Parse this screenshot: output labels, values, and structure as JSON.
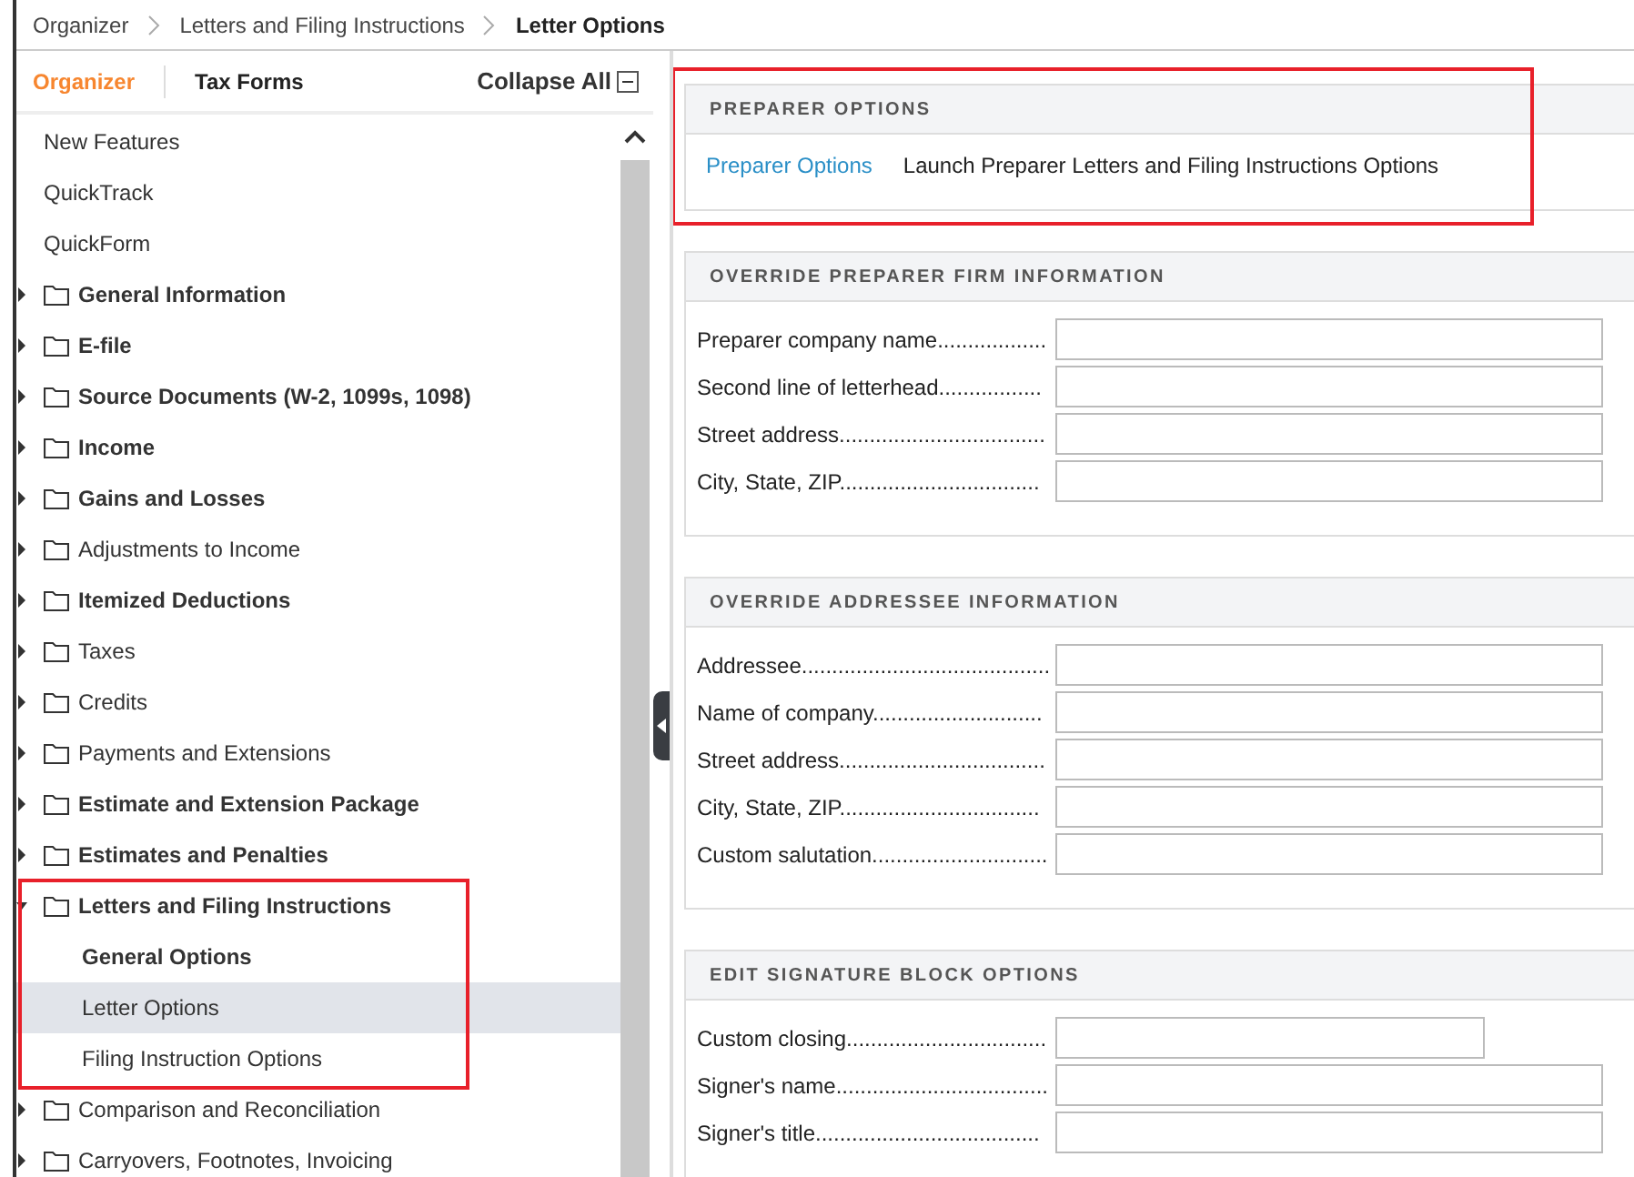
{
  "breadcrumb": [
    "Organizer",
    "Letters and Filing Instructions",
    "Letter Options"
  ],
  "sidebar": {
    "tabs": [
      {
        "label": "Organizer",
        "selected": true
      },
      {
        "label": "Tax Forms",
        "selected": false
      }
    ],
    "collapse_all": "Collapse All",
    "items": [
      {
        "label": "New Features",
        "kind": "link"
      },
      {
        "label": "QuickTrack",
        "kind": "link"
      },
      {
        "label": "QuickForm",
        "kind": "link"
      },
      {
        "label": "General Information",
        "kind": "folder",
        "bold": true,
        "expanded": false
      },
      {
        "label": "E-file",
        "kind": "folder",
        "bold": true,
        "expanded": false
      },
      {
        "label": "Source Documents (W-2, 1099s, 1098)",
        "kind": "folder",
        "bold": true,
        "expanded": false
      },
      {
        "label": "Income",
        "kind": "folder",
        "bold": true,
        "expanded": false
      },
      {
        "label": "Gains and Losses",
        "kind": "folder",
        "bold": true,
        "expanded": false
      },
      {
        "label": "Adjustments to Income",
        "kind": "folder",
        "bold": false,
        "expanded": false
      },
      {
        "label": "Itemized Deductions",
        "kind": "folder",
        "bold": true,
        "expanded": false
      },
      {
        "label": "Taxes",
        "kind": "folder",
        "bold": false,
        "expanded": false
      },
      {
        "label": "Credits",
        "kind": "folder",
        "bold": false,
        "expanded": false
      },
      {
        "label": "Payments and Extensions",
        "kind": "folder",
        "bold": false,
        "expanded": false
      },
      {
        "label": "Estimate and Extension Package",
        "kind": "folder",
        "bold": true,
        "expanded": false
      },
      {
        "label": "Estimates and Penalties",
        "kind": "folder",
        "bold": true,
        "expanded": false
      },
      {
        "label": "Letters and Filing Instructions",
        "kind": "folder",
        "bold": true,
        "expanded": true,
        "highlighted": true,
        "children": [
          {
            "label": "General Options",
            "bold": true,
            "selected": false
          },
          {
            "label": "Letter Options",
            "bold": false,
            "selected": true
          },
          {
            "label": "Filing Instruction Options",
            "bold": false,
            "selected": false
          }
        ]
      },
      {
        "label": "Comparison and Reconciliation",
        "kind": "folder",
        "bold": false,
        "expanded": false
      },
      {
        "label": "Carryovers, Footnotes, Invoicing",
        "kind": "folder",
        "bold": false,
        "expanded": false
      }
    ]
  },
  "sections": [
    {
      "title": "PREPARER OPTIONS",
      "highlighted": true,
      "kind": "links",
      "link": "Preparer Options",
      "description": "Launch Preparer Letters and Filing Instructions Options"
    },
    {
      "title": "OVERRIDE PREPARER FIRM INFORMATION",
      "kind": "form",
      "fields": [
        {
          "label": "Preparer company name..................",
          "kind": "full"
        },
        {
          "label": "Second line of letterhead.................",
          "kind": "full"
        },
        {
          "label": "Street address..................................",
          "kind": "full"
        },
        {
          "label": "City, State, ZIP.................................",
          "kind": "full"
        }
      ]
    },
    {
      "title": "OVERRIDE ADDRESSEE INFORMATION",
      "kind": "form",
      "fields": [
        {
          "label": "Addressee.........................................",
          "kind": "full"
        },
        {
          "label": "Name of company............................",
          "kind": "full"
        },
        {
          "label": "Street address..................................",
          "kind": "full"
        },
        {
          "label": "City, State, ZIP.................................",
          "kind": "full"
        },
        {
          "label": "Custom salutation.............................",
          "kind": "full"
        }
      ]
    },
    {
      "title": "EDIT SIGNATURE BLOCK OPTIONS",
      "kind": "form",
      "fields": [
        {
          "label": "Custom closing.................................",
          "kind": "short"
        },
        {
          "label": "Signer's name...................................",
          "kind": "full"
        },
        {
          "label": "Signer's title.....................................",
          "kind": "full"
        }
      ]
    }
  ]
}
